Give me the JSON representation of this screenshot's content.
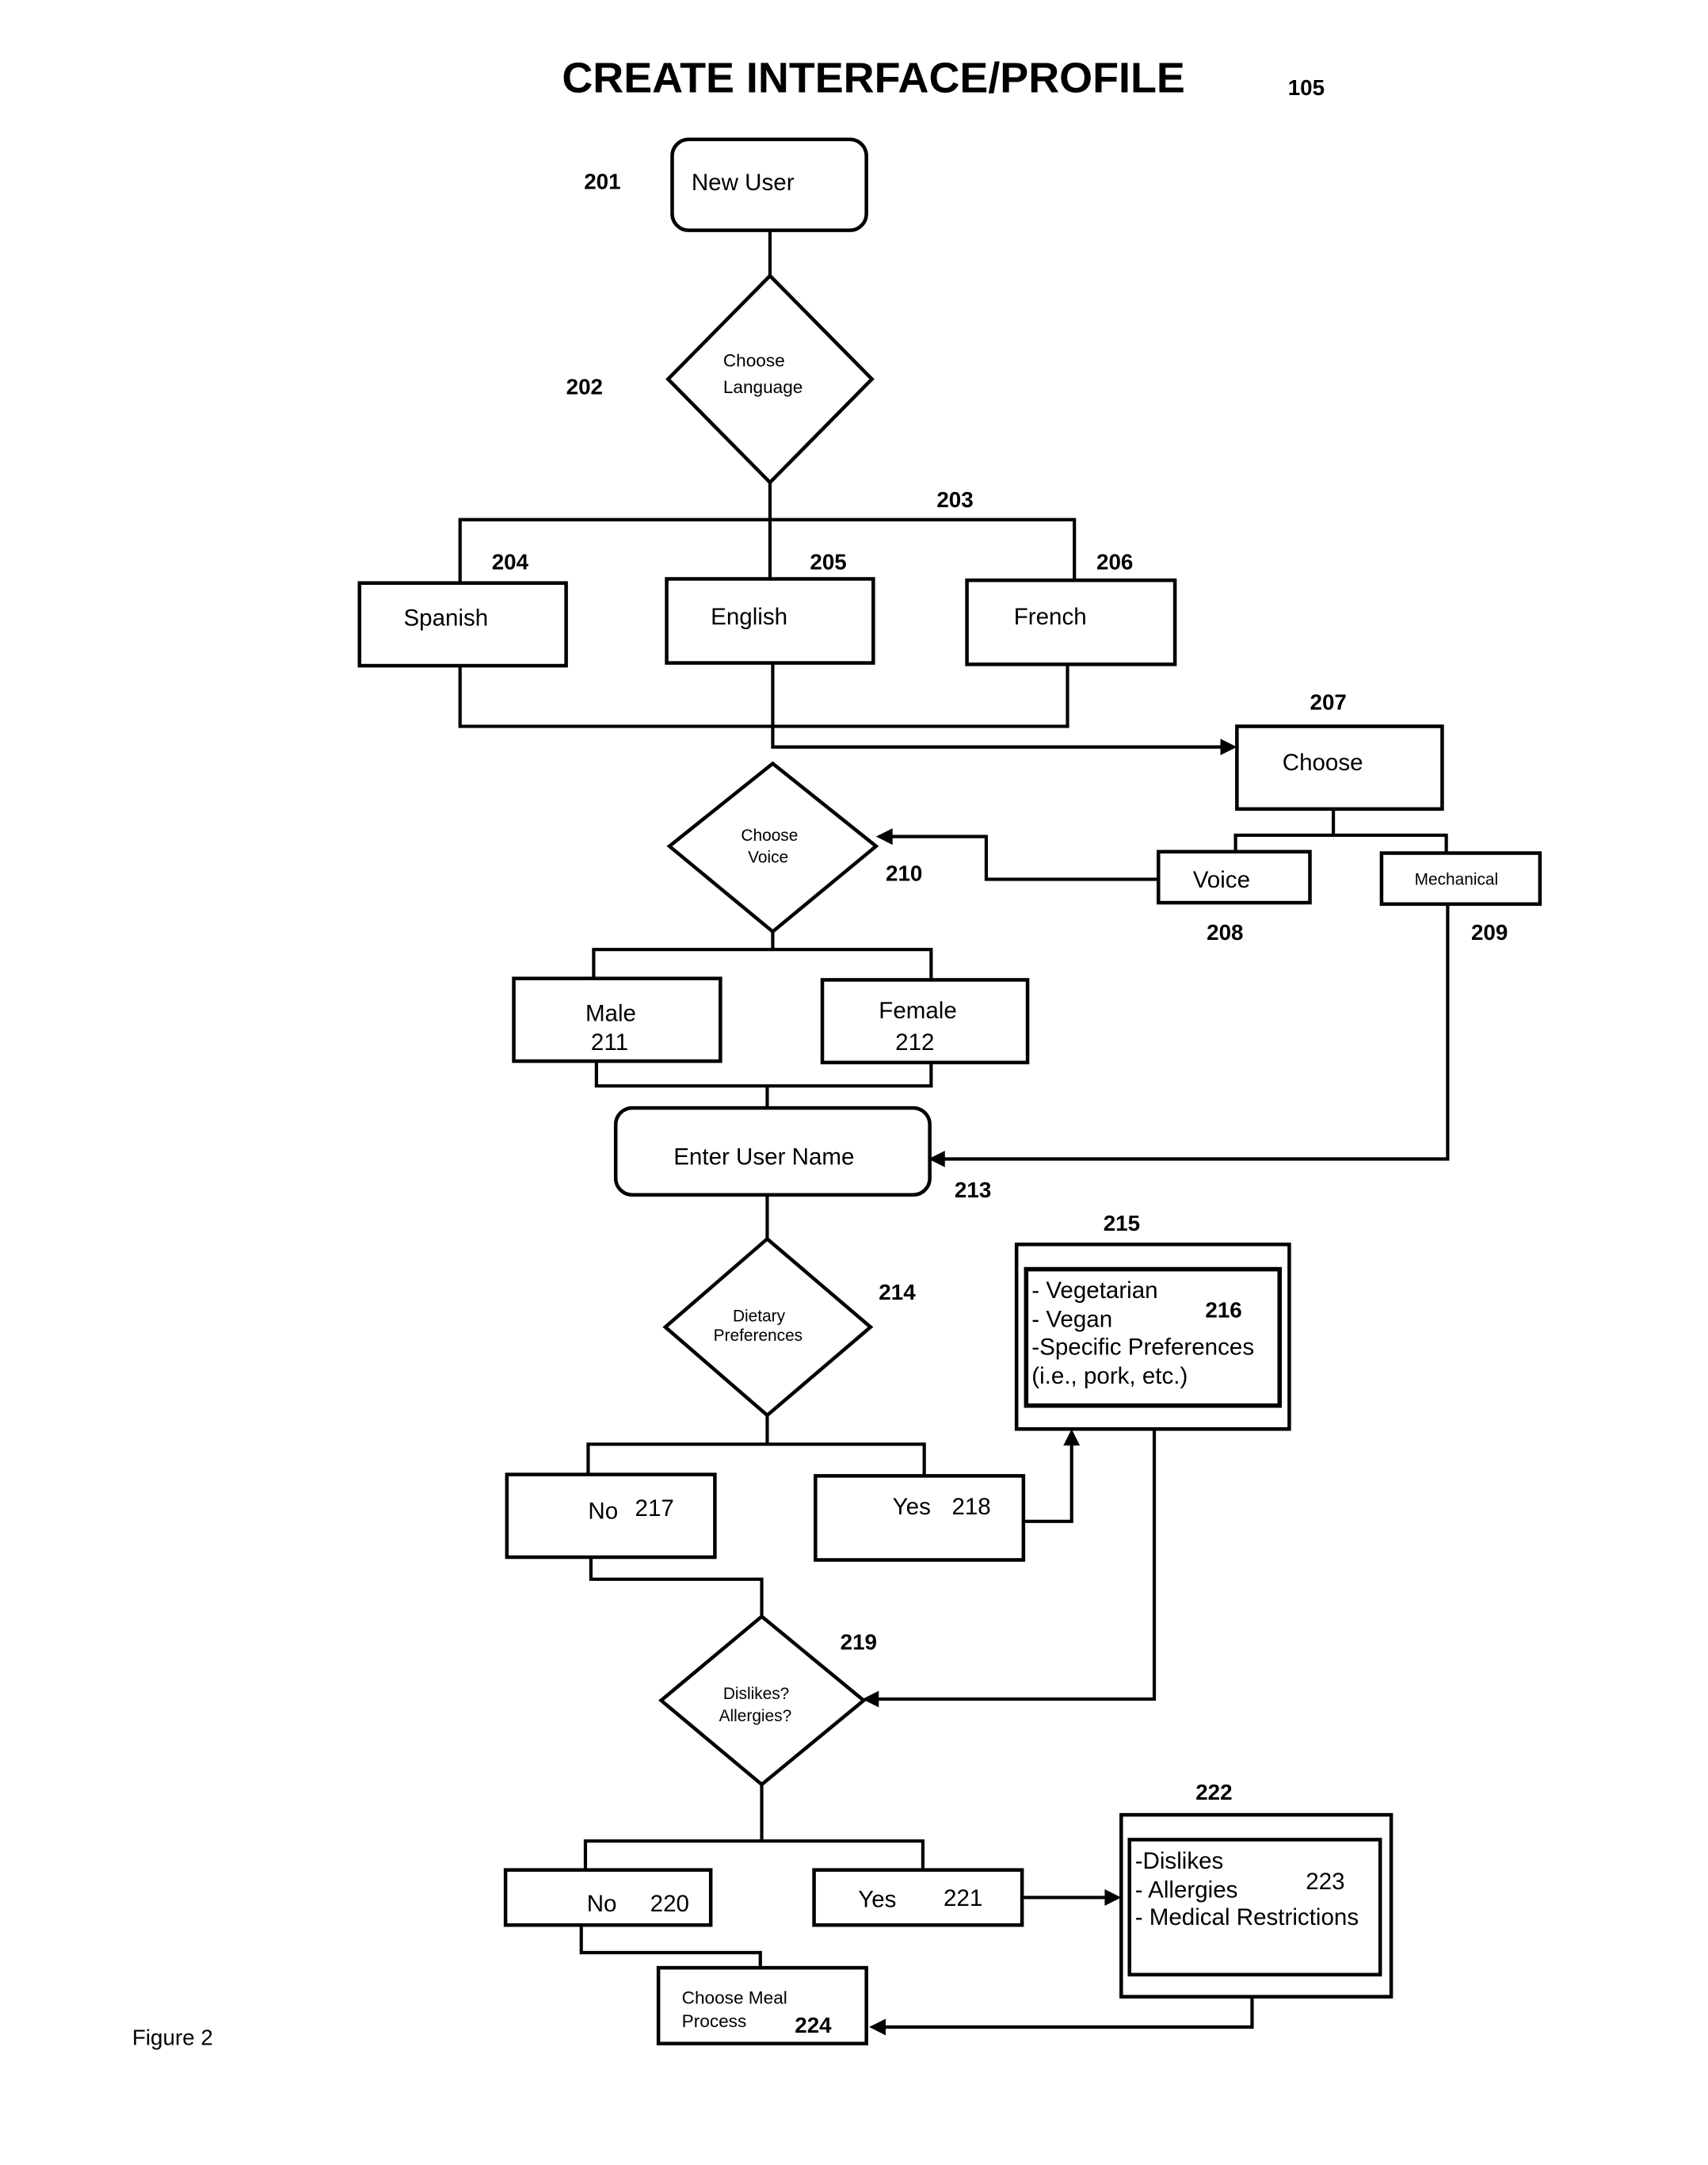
{
  "title": "CREATE INTERFACE/PROFILE",
  "title_ref": "105",
  "figure_label": "Figure 2",
  "nodes": {
    "n201": {
      "ref": "201",
      "label": "New User",
      "shape": "rounded-rect"
    },
    "n202": {
      "ref": "202",
      "lines": [
        "Choose",
        "Language"
      ],
      "shape": "diamond"
    },
    "n203": {
      "ref": "203"
    },
    "n204": {
      "ref": "204",
      "label": "Spanish",
      "shape": "rect"
    },
    "n205": {
      "ref": "205",
      "label": "English",
      "shape": "rect"
    },
    "n206": {
      "ref": "206",
      "label": "French",
      "shape": "rect"
    },
    "n207": {
      "ref": "207",
      "label": "Choose",
      "shape": "rect"
    },
    "n208": {
      "ref": "208",
      "label": "Voice",
      "shape": "rect"
    },
    "n209": {
      "ref": "209",
      "label": "Mechanical",
      "shape": "rect"
    },
    "n210": {
      "ref": "210",
      "lines": [
        "Choose",
        "Voice"
      ],
      "shape": "diamond"
    },
    "n211": {
      "ref": "211",
      "label": "Male",
      "shape": "rect"
    },
    "n212": {
      "ref": "212",
      "label": "Female",
      "shape": "rect"
    },
    "n213": {
      "ref": "213",
      "label": "Enter User Name",
      "shape": "rounded-rect"
    },
    "n214": {
      "ref": "214",
      "lines": [
        "Dietary",
        "Preferences"
      ],
      "shape": "diamond"
    },
    "n215": {
      "ref": "215",
      "shape": "double-rect"
    },
    "n216": {
      "ref": "216",
      "lines": [
        "- Vegetarian",
        "- Vegan",
        "-Specific Preferences",
        "(i.e., pork, etc.)"
      ]
    },
    "n217": {
      "ref": "217",
      "label": "No",
      "shape": "rect"
    },
    "n218": {
      "ref": "218",
      "label": "Yes",
      "shape": "rect"
    },
    "n219": {
      "ref": "219",
      "lines": [
        "Dislikes?",
        "Allergies?"
      ],
      "shape": "diamond"
    },
    "n220": {
      "ref": "220",
      "label": "No",
      "shape": "rect"
    },
    "n221": {
      "ref": "221",
      "label": "Yes",
      "shape": "rect"
    },
    "n222": {
      "ref": "222",
      "shape": "double-rect"
    },
    "n223": {
      "ref": "223",
      "lines": [
        "-Dislikes",
        "- Allergies",
        "- Medical Restrictions"
      ]
    },
    "n224": {
      "ref": "224",
      "lines": [
        "Choose Meal",
        "Process"
      ],
      "shape": "rect"
    }
  },
  "edges": [
    {
      "from": "201",
      "to": "202"
    },
    {
      "from": "202",
      "to": "204"
    },
    {
      "from": "202",
      "to": "205"
    },
    {
      "from": "202",
      "to": "206"
    },
    {
      "from": "204",
      "to": "207"
    },
    {
      "from": "205",
      "to": "207"
    },
    {
      "from": "206",
      "to": "207"
    },
    {
      "from": "207",
      "to": "208"
    },
    {
      "from": "207",
      "to": "209"
    },
    {
      "from": "208",
      "to": "210"
    },
    {
      "from": "209",
      "to": "213"
    },
    {
      "from": "210",
      "to": "211"
    },
    {
      "from": "210",
      "to": "212"
    },
    {
      "from": "211",
      "to": "213"
    },
    {
      "from": "212",
      "to": "213"
    },
    {
      "from": "213",
      "to": "214"
    },
    {
      "from": "214",
      "to": "217"
    },
    {
      "from": "214",
      "to": "218"
    },
    {
      "from": "218",
      "to": "215"
    },
    {
      "from": "215",
      "to": "219"
    },
    {
      "from": "217",
      "to": "219"
    },
    {
      "from": "219",
      "to": "220"
    },
    {
      "from": "219",
      "to": "221"
    },
    {
      "from": "221",
      "to": "222"
    },
    {
      "from": "220",
      "to": "224"
    },
    {
      "from": "222",
      "to": "224"
    }
  ]
}
